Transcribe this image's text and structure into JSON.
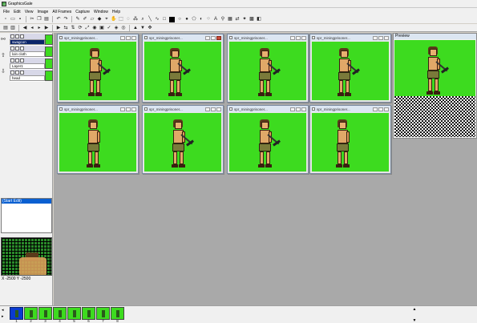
{
  "app": {
    "title": "GraphicsGale"
  },
  "menu": [
    "File",
    "Edit",
    "View",
    "Image",
    "All Frames",
    "Capture",
    "Window",
    "Help"
  ],
  "layers": [
    {
      "name": "swagcon",
      "selected": true
    },
    {
      "name": "loin cloth",
      "selected": false
    },
    {
      "name": "Layer1",
      "selected": false
    },
    {
      "name": "head",
      "selected": false
    }
  ],
  "frame_list": {
    "selected": "(Start Edit)",
    "items": []
  },
  "status": {
    "coords": "X -2500 Y -2500"
  },
  "frame_windows": [
    {
      "title": "spr_miningprisoner..."
    },
    {
      "title": "spr_miningprisoner..."
    },
    {
      "title": "spr_miningprisoner..."
    },
    {
      "title": "spr_miningprisoner..."
    },
    {
      "title": "spr_miningprisoner..."
    },
    {
      "title": "spr_miningprisoner..."
    },
    {
      "title": "spr_miningprisoner..."
    },
    {
      "title": "spr_miningprisoner..."
    }
  ],
  "preview": {
    "title": "Preview"
  },
  "filmstrip": {
    "numbers": [
      "1",
      "2",
      "3",
      "4",
      "5",
      "6",
      "7",
      "8"
    ]
  },
  "colors": {
    "sprite_bg": "#3ddb1f",
    "workspace": "#a9a9a9",
    "selection": "#0a246a"
  },
  "icons": {
    "toolbar1": [
      "new-icon",
      "open-icon",
      "save-icon",
      "cut-icon",
      "copy-icon",
      "paste-icon",
      "undo-icon",
      "redo-icon",
      "pen-icon",
      "line-icon",
      "rect-icon",
      "ellipse-icon",
      "fill-icon",
      "select-icon",
      "text-icon",
      "zoom-icon"
    ],
    "toolbar2": [
      "layers-icon",
      "frame-icon",
      "prev-frame-icon",
      "next-frame-icon",
      "play-icon",
      "flip-h-icon",
      "flip-v-icon",
      "rotate-icon",
      "color-icon",
      "grid-icon"
    ]
  }
}
